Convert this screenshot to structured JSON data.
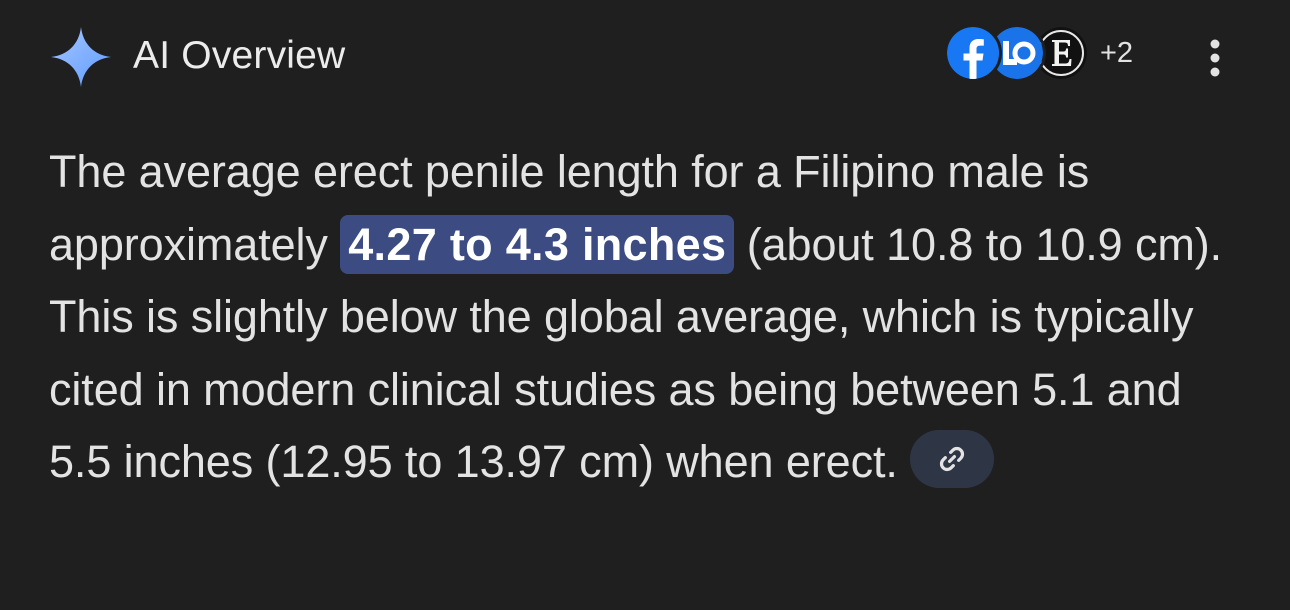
{
  "header": {
    "title": "AI Overview",
    "sources_more_count": "+2",
    "sources": [
      {
        "icon": "facebook-icon",
        "color": "#1877f2"
      },
      {
        "icon": "source-logo-icon",
        "color": "#1a73e8"
      },
      {
        "icon": "source-e-icon",
        "color": "#111111"
      }
    ],
    "menu_icon": "more-vert-icon"
  },
  "answer": {
    "text_before": "The average erect penile length for a Filipino male is approximately ",
    "highlight": "4.27 to 4.3 inches",
    "text_after": " (about 10.8 to 10.9 cm). This is slightly below the global average, which is typically cited in modern clinical studies as being between 5.1 and 5.5 inches (12.95 to 13.97 cm) when erect.",
    "link_icon": "link-icon"
  },
  "colors": {
    "background": "#1f1f1f",
    "text": "#e3e3e3",
    "highlight_bg": "#3c4b82",
    "highlight_text": "#ffffff",
    "chip_bg": "#2e3646",
    "sparkle": "#8ab4f8"
  }
}
